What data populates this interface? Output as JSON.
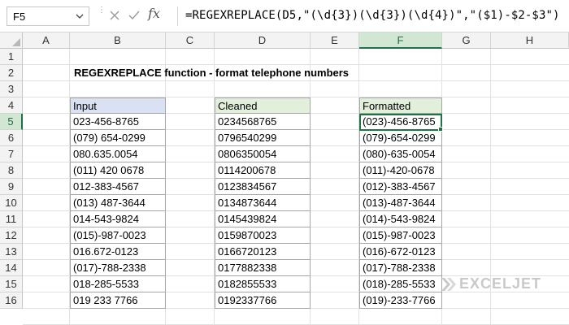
{
  "formula_bar": {
    "name_box": "F5",
    "formula": "=REGEXREPLACE(D5,\"(\\d{3})(\\d{3})(\\d{4})\",\"($1)-$2-$3\")",
    "fx_label": "fx"
  },
  "sheet": {
    "columns": [
      "A",
      "B",
      "C",
      "D",
      "E",
      "F",
      "G",
      "H"
    ],
    "rows": [
      "1",
      "2",
      "3",
      "4",
      "5",
      "6",
      "7",
      "8",
      "9",
      "10",
      "11",
      "12",
      "13",
      "14",
      "15",
      "16"
    ],
    "selected_column": "F",
    "selected_row": "5",
    "title": "REGEXREPLACE function - format telephone numbers"
  },
  "tables": {
    "input": {
      "header": "Input",
      "header_color": "#d9e1f2",
      "values": [
        "023-456-8765",
        "(079) 654-0299",
        "080.635.0054",
        "(011) 420 0678",
        "012-383-4567",
        "(013) 487-3644",
        "014-543-9824",
        "(015)-987-0023",
        "016.672-0123",
        "(017)-788-2338",
        "018-285-5533",
        "019 233 7766"
      ]
    },
    "cleaned": {
      "header": "Cleaned",
      "header_color": "#e2efda",
      "values": [
        "0234568765",
        "0796540299",
        "0806350054",
        "0114200678",
        "0123834567",
        "0134873644",
        "0145439824",
        "0159870023",
        "0166720123",
        "0177882338",
        "0182855533",
        "0192337766"
      ]
    },
    "formatted": {
      "header": "Formatted",
      "header_color": "#e2efda",
      "values": [
        "(023)-456-8765",
        "(079)-654-0299",
        "(080)-635-0054",
        "(011)-420-0678",
        "(012)-383-4567",
        "(013)-487-3644",
        "(014)-543-9824",
        "(015)-987-0023",
        "(016)-672-0123",
        "(017)-788-2338",
        "(018)-285-5533",
        "(019)-233-7766"
      ]
    }
  },
  "watermark": {
    "text": "EXCELJET"
  },
  "colors": {
    "selection": "#217346",
    "grid": "#e1e1e1",
    "header_bg": "#f3f3f3"
  }
}
